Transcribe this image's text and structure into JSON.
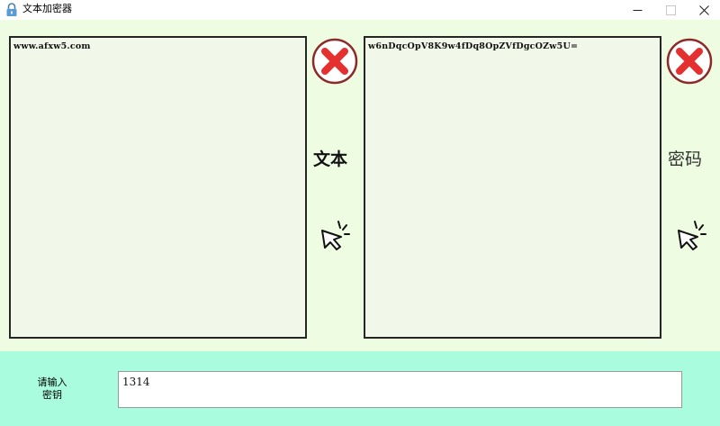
{
  "window": {
    "title": "文本加密器",
    "icons": {
      "app": "lock-icon",
      "minimize": "minimize-icon",
      "maximize": "maximize-icon",
      "close": "close-icon"
    }
  },
  "plain_panel": {
    "content": "www.afxw5.com",
    "label": "文本",
    "clear_icon": "red-x-circle-icon",
    "action_icon": "click-cursor-icon"
  },
  "cipher_panel": {
    "content": "w6nDqcOpV8K9w4fDq8OpZVfDgcOZw5U=",
    "label": "密码",
    "clear_icon": "red-x-circle-icon",
    "action_icon": "click-cursor-icon"
  },
  "key_section": {
    "label_line1": "请输入",
    "label_line2": "密钥",
    "value": "1314"
  },
  "colors": {
    "main_bg": "#eefde1",
    "textbox_bg": "#f1f8ea",
    "bottom_bg": "#a9fcdd",
    "clear_red": "#e53030"
  }
}
